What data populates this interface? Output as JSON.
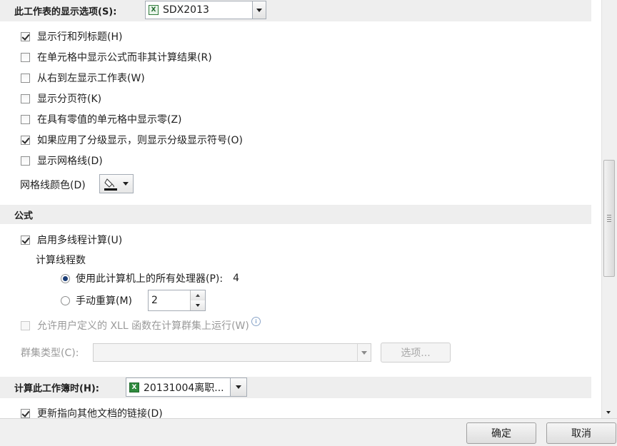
{
  "sheet_section": {
    "label": "此工作表的显示选项(S):",
    "sheet_name": "SDX2013",
    "sheet_icon": "excel-sheet-icon"
  },
  "sheet_options": [
    {
      "label": "显示行和列标题(H)",
      "checked": true
    },
    {
      "label": "在单元格中显示公式而非其计算结果(R)",
      "checked": false
    },
    {
      "label": "从右到左显示工作表(W)",
      "checked": false
    },
    {
      "label": "显示分页符(K)",
      "checked": false
    },
    {
      "label": "在具有零值的单元格中显示零(Z)",
      "checked": false
    },
    {
      "label": "如果应用了分级显示，则显示分级显示符号(O)",
      "checked": true
    },
    {
      "label": "显示网格线(D)",
      "checked": false
    }
  ],
  "gridline_color": {
    "label": "网格线颜色(D)",
    "icon": "paint-bucket-icon",
    "color": "#000000"
  },
  "formula_section": {
    "label": "公式"
  },
  "multithread": {
    "label": "启用多线程计算(U)",
    "checked": true
  },
  "thread_count": {
    "heading": "计算线程数",
    "use_all_label": "使用此计算机上的所有处理器(P):",
    "processor_count": "4",
    "manual_label": "手动重算(M)",
    "manual_value": "2",
    "selected": "use_all"
  },
  "xll": {
    "label": "允许用户定义的 XLL 函数在计算群集上运行(W)",
    "checked": false,
    "enabled": false,
    "info_icon": "info-icon"
  },
  "cluster": {
    "label": "群集类型(C):",
    "value": "",
    "options_button": "选项..."
  },
  "workbook_section": {
    "label": "计算此工作簿时(H):",
    "workbook_name": "20131004离职...",
    "workbook_icon": "excel-workbook-icon"
  },
  "update_links": {
    "label": "更新指向其他文档的链接(D)",
    "checked": true
  },
  "footer": {
    "ok": "确定",
    "cancel": "取消"
  },
  "colors": {
    "section_bg": "#eeeeee",
    "radio_dot": "#1b3d76"
  }
}
